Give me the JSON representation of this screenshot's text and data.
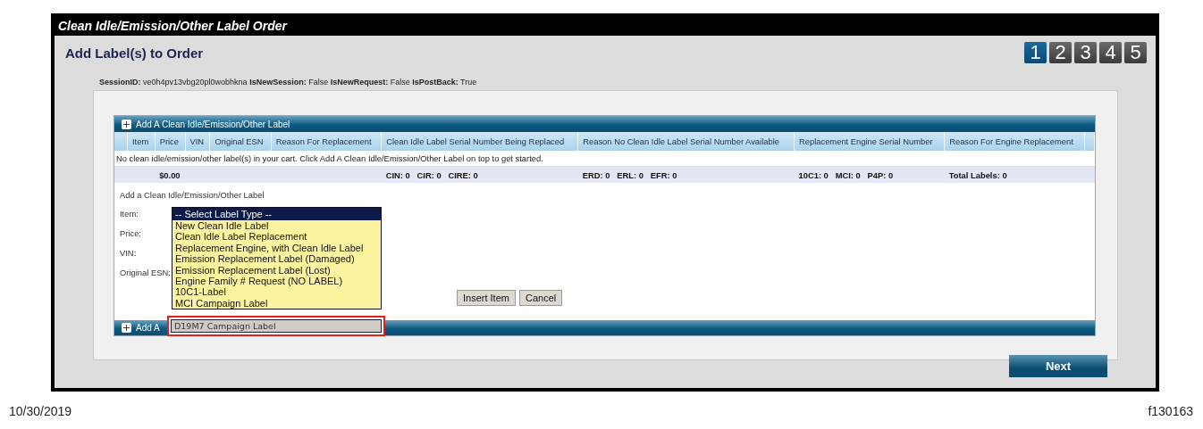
{
  "window": {
    "title": "Clean Idle/Emission/Other Label Order"
  },
  "page_title": "Add Label(s) to Order",
  "steps": [
    {
      "label": "1",
      "selected": true
    },
    {
      "label": "2",
      "selected": false
    },
    {
      "label": "3",
      "selected": false
    },
    {
      "label": "4",
      "selected": false
    },
    {
      "label": "5",
      "selected": false
    }
  ],
  "session_info": "**SessionID:** ve0h4pv13vbg20pl0wobhkna **IsNewSession:** False **IsNewRequest:** False **IsPostBack:** True",
  "grid": {
    "add_bar_label": "Add A Clean Idle/Emission/Other Label",
    "columns": [
      {
        "header": "Item"
      },
      {
        "header": "Price",
        "total": "$0.00"
      },
      {
        "header": "VIN"
      },
      {
        "header": "Original ESN"
      },
      {
        "header": "Reason For Replacement"
      },
      {
        "header": "Clean Idle Label Serial Number Being Replaced",
        "total": "CIN: 0   CIR: 0   CIRE: 0"
      },
      {
        "header": "Reason No Clean Idle Label Serial Number Available",
        "total": "ERD: 0   ERL: 0   EFR: 0"
      },
      {
        "header": "Replacement Engine Serial Number",
        "total": "10C1: 0   MCI: 0   P4P: 0"
      },
      {
        "header": "Reason For Engine Replacement",
        "total": "Total Labels: 0"
      }
    ],
    "empty_message": "No clean idle/emission/other label(s) in your cart. Click Add A Clean Idle/Emission/Other Label on top to get started."
  },
  "form": {
    "heading": "Add a Clean Idle/Emission/Other Label",
    "labels": [
      "Item:",
      "Price:",
      "VIN:",
      "Original ESN:"
    ],
    "dropdown": {
      "options": [
        {
          "label": "-- Select Label Type --",
          "selected": true
        },
        {
          "label": "New Clean Idle Label",
          "selected": false
        },
        {
          "label": "Clean Idle Label Replacement",
          "selected": false
        },
        {
          "label": "Replacement Engine, with Clean Idle Label",
          "selected": false
        },
        {
          "label": "Emission Replacement Label (Damaged)",
          "selected": false
        },
        {
          "label": "Emission Replacement Label (Lost)",
          "selected": false
        },
        {
          "label": "Engine Family # Request (NO LABEL)",
          "selected": false
        },
        {
          "label": "10C1-Label",
          "selected": false
        },
        {
          "label": "MCI Campaign Label",
          "selected": false
        }
      ],
      "callout_option": "D19M7 Campaign Label"
    },
    "buttons": [
      "Insert Item",
      "Cancel"
    ]
  },
  "bottom_bar_label": "Add A",
  "next_button": "Next",
  "footer": {
    "date": "10/30/2019",
    "figure_id": "f130163"
  }
}
